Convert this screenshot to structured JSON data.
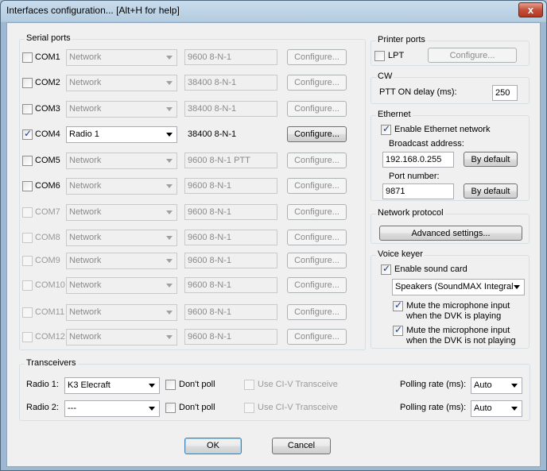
{
  "window": {
    "title": "Interfaces configuration... [Alt+H for help]",
    "close_label": "x"
  },
  "serial_ports": {
    "title": "Serial ports",
    "configure_label": "Configure...",
    "rows": [
      {
        "label": "COM1",
        "checked": false,
        "enabled": true,
        "device": "Network",
        "settings": "9600 8-N-1",
        "active": false
      },
      {
        "label": "COM2",
        "checked": false,
        "enabled": true,
        "device": "Network",
        "settings": "38400 8-N-1",
        "active": false
      },
      {
        "label": "COM3",
        "checked": false,
        "enabled": true,
        "device": "Network",
        "settings": "38400 8-N-1",
        "active": false
      },
      {
        "label": "COM4",
        "checked": true,
        "enabled": true,
        "device": "Radio 1",
        "settings": "38400 8-N-1",
        "active": true
      },
      {
        "label": "COM5",
        "checked": false,
        "enabled": true,
        "device": "Network",
        "settings": "9600 8-N-1 PTT",
        "active": false
      },
      {
        "label": "COM6",
        "checked": false,
        "enabled": true,
        "device": "Network",
        "settings": "9600 8-N-1",
        "active": false
      },
      {
        "label": "COM7",
        "checked": false,
        "enabled": false,
        "device": "Network",
        "settings": "9600 8-N-1",
        "active": false
      },
      {
        "label": "COM8",
        "checked": false,
        "enabled": false,
        "device": "Network",
        "settings": "9600 8-N-1",
        "active": false
      },
      {
        "label": "COM9",
        "checked": false,
        "enabled": false,
        "device": "Network",
        "settings": "9600 8-N-1",
        "active": false
      },
      {
        "label": "COM10",
        "checked": false,
        "enabled": false,
        "device": "Network",
        "settings": "9600 8-N-1",
        "active": false
      },
      {
        "label": "COM11",
        "checked": false,
        "enabled": false,
        "device": "Network",
        "settings": "9600 8-N-1",
        "active": false
      },
      {
        "label": "COM12",
        "checked": false,
        "enabled": false,
        "device": "Network",
        "settings": "9600 8-N-1",
        "active": false
      }
    ]
  },
  "printer_ports": {
    "title": "Printer ports",
    "lpt_label": "LPT",
    "lpt_checked": false,
    "configure_label": "Configure..."
  },
  "cw": {
    "title": "CW",
    "ptt_label": "PTT ON delay (ms):",
    "ptt_value": "250"
  },
  "ethernet": {
    "title": "Ethernet",
    "enable_label": "Enable Ethernet network",
    "enable_checked": true,
    "broadcast_label": "Broadcast address:",
    "broadcast_value": "192.168.0.255",
    "port_label": "Port number:",
    "port_value": "9871",
    "default_label": "By default"
  },
  "network_protocol": {
    "title": "Network protocol",
    "advanced_label": "Advanced settings..."
  },
  "voice_keyer": {
    "title": "Voice keyer",
    "enable_label": "Enable sound card",
    "enable_checked": true,
    "device": "Speakers (SoundMAX Integral",
    "mute_playing_line1": "Mute the microphone input",
    "mute_playing_line2": "when the DVK is playing",
    "mute_playing_checked": true,
    "mute_not_playing_line1": "Mute the microphone input",
    "mute_not_playing_line2": "when the DVK is not playing",
    "mute_not_playing_checked": true
  },
  "transceivers": {
    "title": "Transceivers",
    "dont_poll_label": "Don't poll",
    "civ_label": "Use CI-V Transceive",
    "polling_label": "Polling rate (ms):",
    "radios": [
      {
        "label": "Radio 1:",
        "model": "K3 Elecraft",
        "polling": "Auto"
      },
      {
        "label": "Radio 2:",
        "model": "---",
        "polling": "Auto"
      }
    ]
  },
  "buttons": {
    "ok": "OK",
    "cancel": "Cancel"
  }
}
